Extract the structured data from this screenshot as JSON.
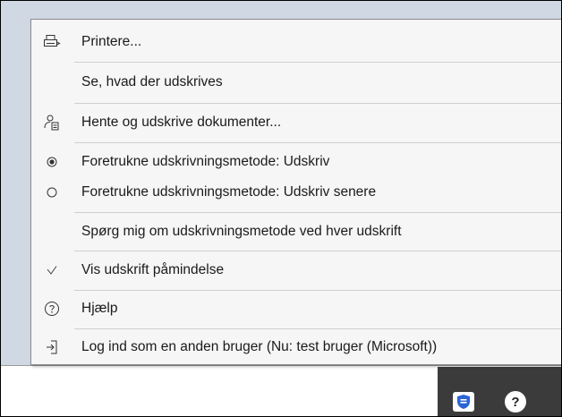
{
  "menu": {
    "items": [
      {
        "label": "Printere...",
        "icon": "printer-icon"
      },
      {
        "label": "Se, hvad der udskrives",
        "icon": ""
      },
      {
        "label": "Hente og udskrive dokumenter...",
        "icon": "user-document-icon"
      },
      {
        "label": "Foretrukne udskrivningsmetode: Udskriv",
        "icon": "radio-selected-icon"
      },
      {
        "label": "Foretrukne udskrivningsmetode: Udskriv senere",
        "icon": "radio-empty-icon"
      },
      {
        "label": "Spørg mig om udskrivningsmetode ved hver udskrift",
        "icon": ""
      },
      {
        "label": "Vis udskrift påmindelse",
        "icon": "checkmark-icon"
      },
      {
        "label": "Hjælp",
        "icon": "help-icon"
      },
      {
        "label": "Log ind som en anden bruger (Nu: test bruger (Microsoft))",
        "icon": "sign-in-icon"
      }
    ]
  },
  "taskbar": {
    "tray_icons": [
      "shield-icon",
      "help-icon"
    ],
    "shield_color": "#2b64d6"
  }
}
